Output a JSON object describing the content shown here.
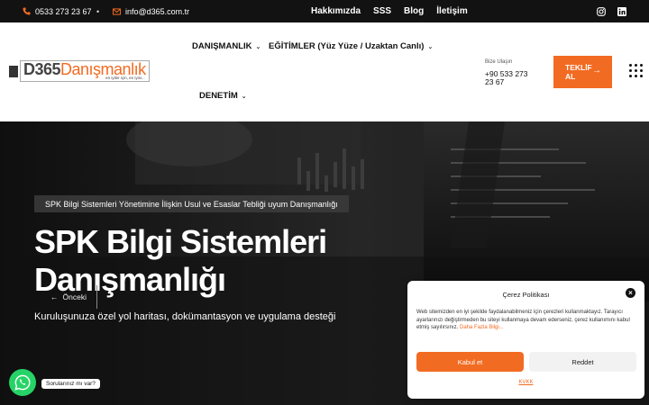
{
  "topbar": {
    "phone": "0533 273 23 67",
    "email": "info@d365.com.tr",
    "nav": [
      "Hakkımızda",
      "SSS",
      "Blog",
      "İletişim"
    ],
    "social": [
      "instagram-icon",
      "linkedin-icon"
    ]
  },
  "header": {
    "logo": {
      "brand": "D365",
      "name": "Danışmanlık",
      "tagline": "en iyiler için, en iyisi..."
    },
    "nav": {
      "item1": "DANIŞMANLIK",
      "item2": "EĞİTİMLER (Yüz Yüze / Uzaktan Canlı)",
      "item3": "DENETİM"
    },
    "contact_label": "Bize Ulaşın",
    "contact_phone": "+90 533 273 23 67",
    "cta": "TEKLİF AL"
  },
  "hero": {
    "breadcrumb": "SPK Bilgi Sistemleri Yönetimine İlişkin Usul ve Esaslar Tebliği uyum Danışmanlığı",
    "title": "SPK Bilgi Sistemleri Danışmanlığı",
    "subtitle": "Kuruluşunuza özel yol haritası, dokümantasyon ve uygulama desteği",
    "prev": "Önceki"
  },
  "whatsapp": {
    "tooltip": "Sorularınız mı var?"
  },
  "cookie": {
    "title": "Çerez Politikası",
    "body": "Web sitemizden en iyi şekilde faydalanabilmeniz için çerezleri kullanmaktayız. Tarayıcı ayarlarınızı değiştirmeden bu siteyi kullanmaya devam ederseniz, çerez kullanımını kabul etmiş sayılırsınız.",
    "more": "Daha Fazla Bilgi...",
    "accept": "Kabul et",
    "deny": "Reddet",
    "kvkk": "KVKK"
  },
  "colors": {
    "accent": "#f26b22",
    "topbar": "#121212",
    "whatsapp": "#25d366"
  }
}
